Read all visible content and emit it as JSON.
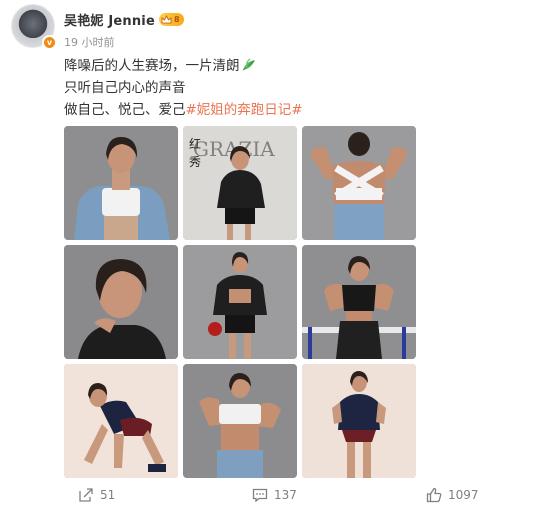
{
  "author": {
    "name": "吴艳妮 Jennie",
    "vip_level": "8",
    "verified_badge": "v",
    "timestamp": "19 小时前"
  },
  "post": {
    "lines": [
      "降噪后的人生赛场，一片清朗",
      "只听自己内心的声音",
      "做自己、悦己、爱己"
    ],
    "leaf_emoji": "leaf-icon",
    "hashtag": "#妮姐的奔跑日记#"
  },
  "photos": [
    {
      "alt": "photo-1",
      "magazine_text": "",
      "bg": "#8d8d8f"
    },
    {
      "alt": "photo-2",
      "magazine_text": "红秀 GRAZIA",
      "bg": "#d8d7d3"
    },
    {
      "alt": "photo-3",
      "magazine_text": "",
      "bg": "#9a9a9c"
    },
    {
      "alt": "photo-4",
      "magazine_text": "",
      "bg": "#8a8a8c"
    },
    {
      "alt": "photo-5",
      "magazine_text": "",
      "bg": "#9c9c9e"
    },
    {
      "alt": "photo-6",
      "magazine_text": "",
      "bg": "#8f8f91"
    },
    {
      "alt": "photo-7",
      "magazine_text": "",
      "bg": "#f1e4da"
    },
    {
      "alt": "photo-8",
      "magazine_text": "",
      "bg": "#8c8c8e"
    },
    {
      "alt": "photo-9",
      "magazine_text": "",
      "bg": "#efe1d7"
    }
  ],
  "actions": {
    "share_count": "51",
    "comment_count": "137",
    "like_count": "1097"
  },
  "colors": {
    "hashtag": "#eb7350",
    "muted": "#808080",
    "badge_orange": "#f28b16"
  }
}
